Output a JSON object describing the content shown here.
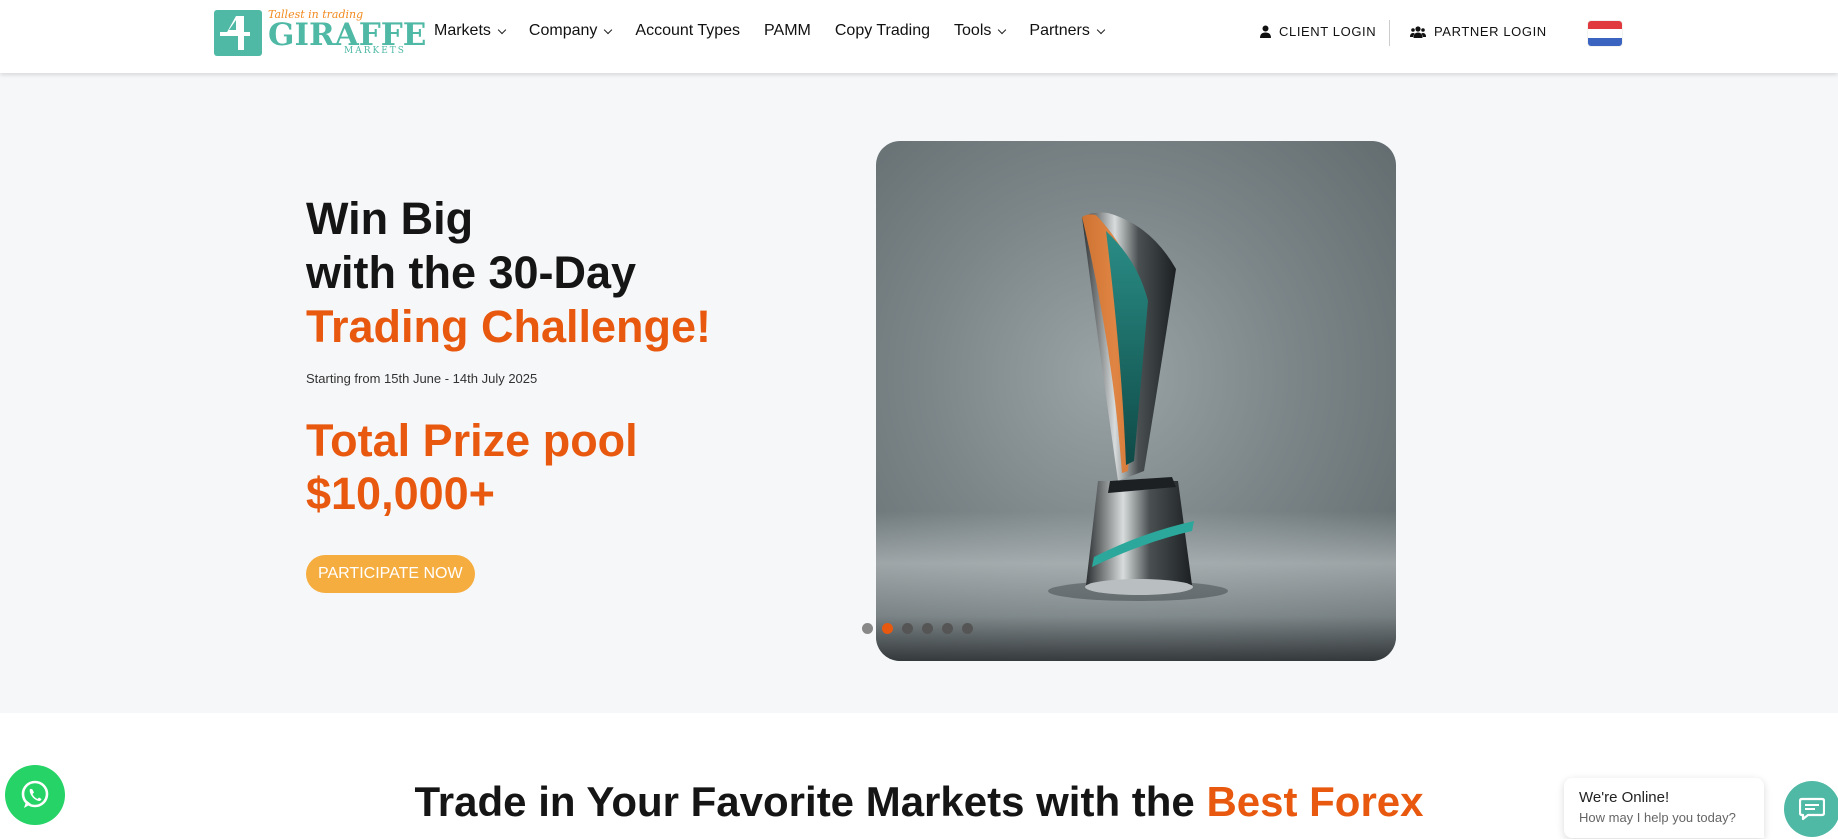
{
  "brand": {
    "tagline": "Tallest in trading",
    "name": "GIRAFFE",
    "sub": "MARKETS",
    "color": "#4fb9a6"
  },
  "nav": {
    "items": [
      {
        "label": "Markets",
        "dropdown": true
      },
      {
        "label": "Company",
        "dropdown": true
      },
      {
        "label": "Account Types",
        "dropdown": false
      },
      {
        "label": "PAMM",
        "dropdown": false
      },
      {
        "label": "Copy Trading",
        "dropdown": false
      },
      {
        "label": "Tools",
        "dropdown": true
      },
      {
        "label": "Partners",
        "dropdown": true
      }
    ],
    "client_login": "CLIENT LOGIN",
    "partner_login": "PARTNER LOGIN",
    "language_flag": "netherlands-flag-icon"
  },
  "hero": {
    "line1": "Win Big",
    "line2": "with the 30-Day",
    "line3": "Trading Challenge!",
    "dates": "Starting from 15th June - 14th July 2025",
    "prize_line1": "Total Prize pool",
    "prize_line2": "$10,000+",
    "cta": "PARTICIPATE NOW",
    "slider": {
      "total": 6,
      "active_index": 1
    },
    "accent_color": "#e8590f"
  },
  "section": {
    "title_plain": "Trade in Your Favorite Markets with the ",
    "title_accent": "Best Forex"
  },
  "chat": {
    "title": "We're Online!",
    "subtitle": "How may I help you today?"
  },
  "icons": {
    "whatsapp": "whatsapp-icon",
    "chat": "chat-icon",
    "user": "user-icon",
    "users": "users-icon"
  }
}
